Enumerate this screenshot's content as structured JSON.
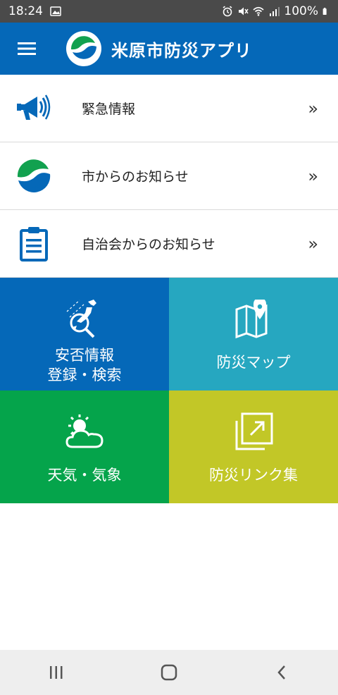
{
  "status_bar": {
    "time": "18:24",
    "battery": "100%"
  },
  "app_bar": {
    "title": "米原市防災アプリ"
  },
  "menu": {
    "items": [
      {
        "label": "緊急情報",
        "icon": "megaphone-icon"
      },
      {
        "label": "市からのお知らせ",
        "icon": "city-logo-icon"
      },
      {
        "label": "自治会からのお知らせ",
        "icon": "clipboard-icon"
      }
    ],
    "chevron": "»"
  },
  "tiles": {
    "safety": {
      "line1": "安否情報",
      "line2": "登録・検索",
      "color": "#0568b8"
    },
    "map": {
      "label": "防災マップ",
      "color": "#26a7c0"
    },
    "weather": {
      "label": "天気・気象",
      "color": "#05a44b"
    },
    "links": {
      "label": "防災リンク集",
      "color": "#c2c727"
    }
  },
  "colors": {
    "primary": "#0568b8",
    "status_bar": "#4a4a4a"
  }
}
